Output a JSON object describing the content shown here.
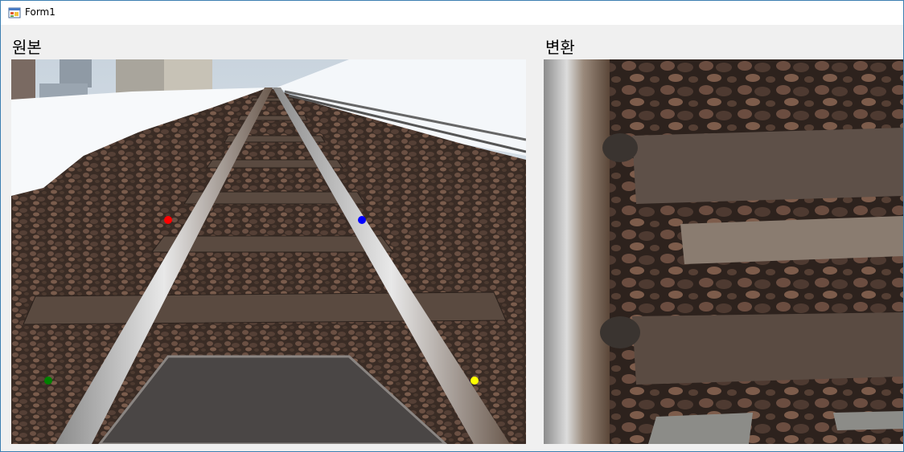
{
  "window": {
    "title": "Form1"
  },
  "labels": {
    "original": "원본",
    "transformed": "변환"
  },
  "images": {
    "original": "railway-tracks-photo",
    "transformed": "railway-tracks-warped-closeup"
  },
  "markers": [
    {
      "name": "red-marker",
      "color": "#ff0000"
    },
    {
      "name": "blue-marker",
      "color": "#0000ff"
    },
    {
      "name": "green-marker",
      "color": "#008000"
    },
    {
      "name": "yellow-marker",
      "color": "#ffff00"
    }
  ]
}
